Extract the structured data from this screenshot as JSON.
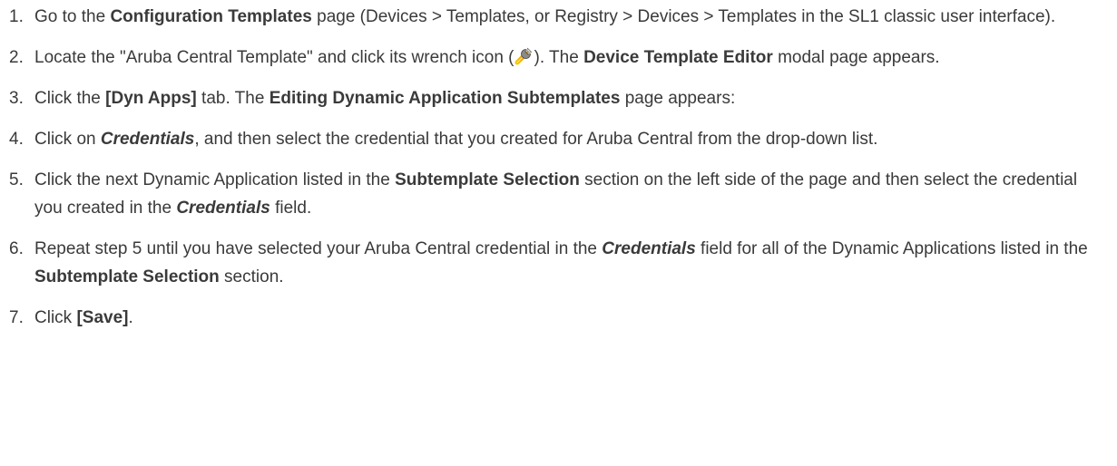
{
  "steps": [
    {
      "number": "1.",
      "parts": [
        "Go to the ",
        "Configuration Templates",
        " page (Devices > Templates, or Registry > Devices > Templates in the SL1 classic user interface)."
      ]
    },
    {
      "number": "2.",
      "parts": [
        "Locate the \"Aruba Central Template\" and click its wrench icon (",
        "). The ",
        "Device Template Editor",
        " modal page appears."
      ],
      "icon": "wrench-icon"
    },
    {
      "number": "3.",
      "parts": [
        "Click the ",
        "[Dyn Apps]",
        " tab. The ",
        "Editing Dynamic Application Subtemplates",
        " page appears:"
      ]
    },
    {
      "number": "4.",
      "parts": [
        "Click on ",
        "Credentials",
        ", and then select the credential that you created for Aruba Central from the drop-down list."
      ]
    },
    {
      "number": "5.",
      "parts": [
        "Click the next Dynamic Application listed in the ",
        "Subtemplate Selection",
        " section on the left side of the page and then select the credential you created in the ",
        "Credentials",
        " field."
      ]
    },
    {
      "number": "6.",
      "parts": [
        "Repeat step 5 until you have selected your Aruba Central credential in the ",
        "Credentials",
        " field for all of the Dynamic Applications listed in the ",
        "Subtemplate Selection",
        " section."
      ]
    },
    {
      "number": "7.",
      "parts": [
        "Click ",
        "[Save]",
        "."
      ]
    }
  ]
}
